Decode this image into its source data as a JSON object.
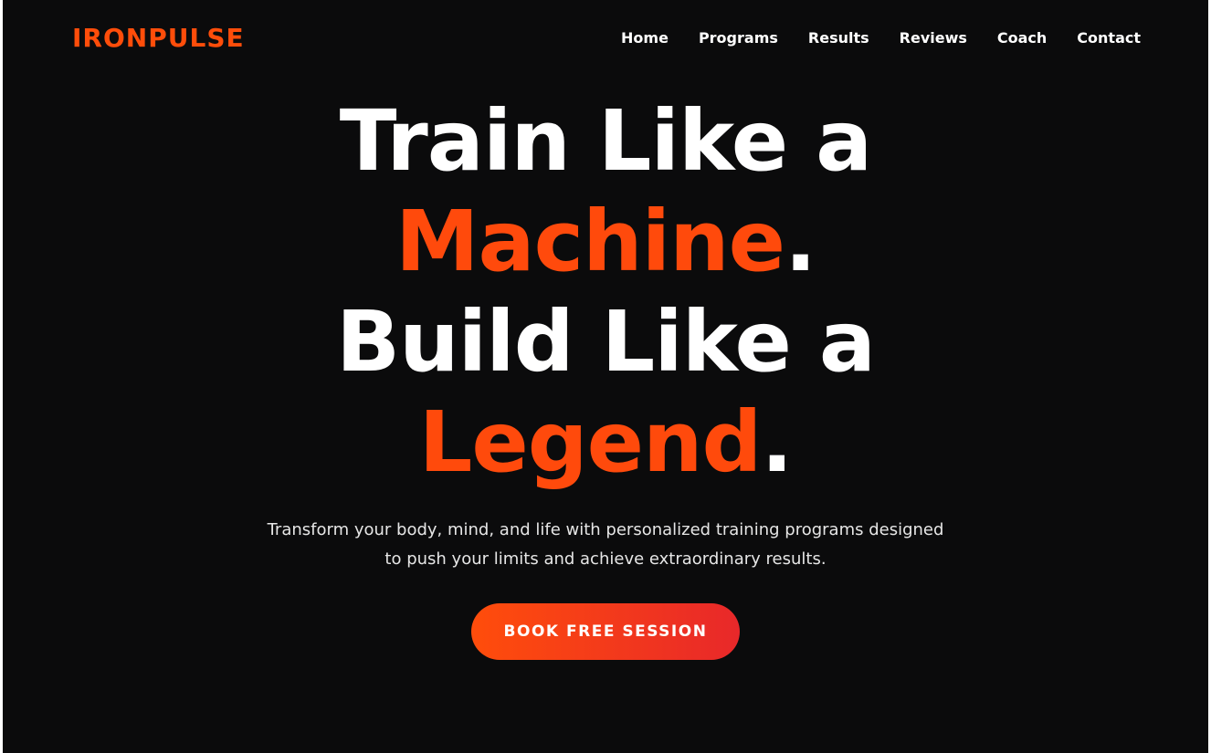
{
  "brand": {
    "logo": "IRONPULSE",
    "accent_color": "#ff4d0a"
  },
  "nav": {
    "items": [
      {
        "label": "Home"
      },
      {
        "label": "Programs"
      },
      {
        "label": "Results"
      },
      {
        "label": "Reviews"
      },
      {
        "label": "Coach"
      },
      {
        "label": "Contact"
      }
    ]
  },
  "hero": {
    "line1": "Train Like a",
    "line2_accent": "Machine",
    "line2_punct": ".",
    "line3": "Build Like a",
    "line4_accent": "Legend",
    "line4_punct": ".",
    "subtitle_line1": "Transform your body, mind, and life with personalized training programs designed",
    "subtitle_line2": "to push your limits and achieve extraordinary results.",
    "cta_label": "BOOK FREE SESSION"
  },
  "colors": {
    "background": "#0b0b0c",
    "accent": "#ff4a0c",
    "cta_gradient_start": "#ff4d0b",
    "cta_gradient_end": "#e8282a"
  }
}
